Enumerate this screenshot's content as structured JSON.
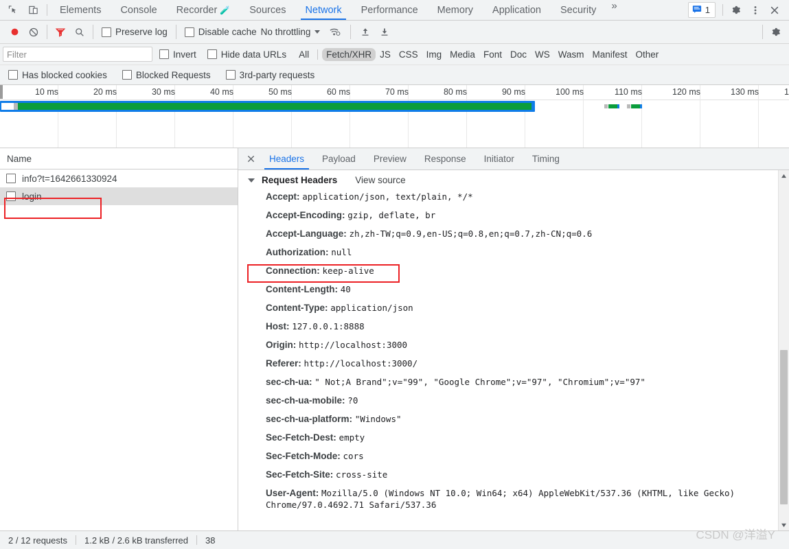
{
  "devtools": {
    "tabs": [
      {
        "label": "Elements",
        "active": false,
        "warn": false
      },
      {
        "label": "Console",
        "active": false,
        "warn": false
      },
      {
        "label": "Recorder",
        "active": false,
        "warn": true
      },
      {
        "label": "Sources",
        "active": false,
        "warn": false
      },
      {
        "label": "Network",
        "active": true,
        "warn": false
      },
      {
        "label": "Performance",
        "active": false,
        "warn": false
      },
      {
        "label": "Memory",
        "active": false,
        "warn": false
      },
      {
        "label": "Application",
        "active": false,
        "warn": false
      },
      {
        "label": "Security",
        "active": false,
        "warn": false
      }
    ],
    "more_tabs_glyph": "»",
    "message_count": "1",
    "icons": {
      "inspect": "inspect-element-icon",
      "device": "device-toolbar-icon",
      "messages": "message-badge-icon",
      "settings": "gear-icon",
      "kebab": "kebab-menu-icon",
      "close": "close-icon"
    },
    "accent_color": "#1a73e8"
  },
  "network_toolbar": {
    "record_label": "record-button",
    "clear_label": "clear-button",
    "filter_toggle_label": "filter-toggle-button",
    "search_label": "search-button",
    "preserve_log": {
      "label": "Preserve log",
      "checked": false
    },
    "disable_cache": {
      "label": "Disable cache",
      "checked": false
    },
    "throttling": {
      "value": "No throttling"
    },
    "wifi_label": "network-conditions-icon",
    "import_label": "import-har-button",
    "export_label": "export-har-button",
    "settings_label": "network-settings-icon",
    "record_color": "#e8302f",
    "filter_color": "#e8302f"
  },
  "filter_row": {
    "placeholder": "Filter",
    "value": "",
    "invert": {
      "label": "Invert",
      "checked": false
    },
    "hide_data_urls": {
      "label": "Hide data URLs",
      "checked": false
    },
    "types": [
      {
        "label": "All",
        "active": false
      },
      {
        "label": "Fetch/XHR",
        "active": true
      },
      {
        "label": "JS",
        "active": false
      },
      {
        "label": "CSS",
        "active": false
      },
      {
        "label": "Img",
        "active": false
      },
      {
        "label": "Media",
        "active": false
      },
      {
        "label": "Font",
        "active": false
      },
      {
        "label": "Doc",
        "active": false
      },
      {
        "label": "WS",
        "active": false
      },
      {
        "label": "Wasm",
        "active": false
      },
      {
        "label": "Manifest",
        "active": false
      },
      {
        "label": "Other",
        "active": false
      }
    ]
  },
  "checkbox_row": {
    "has_blocked_cookies": {
      "label": "Has blocked cookies",
      "checked": false
    },
    "blocked_requests": {
      "label": "Blocked Requests",
      "checked": false
    },
    "third_party_requests": {
      "label": "3rd-party requests",
      "checked": false
    }
  },
  "overview": {
    "ticks": [
      "10 ms",
      "20 ms",
      "30 ms",
      "40 ms",
      "50 ms",
      "60 ms",
      "70 ms",
      "80 ms",
      "90 ms",
      "100 ms",
      "110 ms",
      "120 ms",
      "130 ms",
      "1"
    ],
    "colors": {
      "blue": "#0f7ce8",
      "green": "#0b9d3b",
      "gray": "#b9b9b9"
    }
  },
  "requests_pane": {
    "column_header": "Name",
    "rows": [
      {
        "name": "info?t=1642661330924",
        "selected": false
      },
      {
        "name": "login",
        "selected": true
      }
    ]
  },
  "detail_pane": {
    "tabs": [
      {
        "label": "Headers",
        "active": true
      },
      {
        "label": "Payload",
        "active": false
      },
      {
        "label": "Preview",
        "active": false
      },
      {
        "label": "Response",
        "active": false
      },
      {
        "label": "Initiator",
        "active": false
      },
      {
        "label": "Timing",
        "active": false
      }
    ],
    "section_title": "Request Headers",
    "view_source": "View source",
    "headers": [
      {
        "name": "Accept:",
        "value": "application/json, text/plain, */*"
      },
      {
        "name": "Accept-Encoding:",
        "value": "gzip, deflate, br"
      },
      {
        "name": "Accept-Language:",
        "value": "zh,zh-TW;q=0.9,en-US;q=0.8,en;q=0.7,zh-CN;q=0.6"
      },
      {
        "name": "Authorization:",
        "value": "null"
      },
      {
        "name": "Connection:",
        "value": "keep-alive"
      },
      {
        "name": "Content-Length:",
        "value": "40"
      },
      {
        "name": "Content-Type:",
        "value": "application/json"
      },
      {
        "name": "Host:",
        "value": "127.0.0.1:8888"
      },
      {
        "name": "Origin:",
        "value": "http://localhost:3000"
      },
      {
        "name": "Referer:",
        "value": "http://localhost:3000/"
      },
      {
        "name": "sec-ch-ua:",
        "value": "\" Not;A Brand\";v=\"99\", \"Google Chrome\";v=\"97\", \"Chromium\";v=\"97\""
      },
      {
        "name": "sec-ch-ua-mobile:",
        "value": "?0"
      },
      {
        "name": "sec-ch-ua-platform:",
        "value": "\"Windows\""
      },
      {
        "name": "Sec-Fetch-Dest:",
        "value": "empty"
      },
      {
        "name": "Sec-Fetch-Mode:",
        "value": "cors"
      },
      {
        "name": "Sec-Fetch-Site:",
        "value": "cross-site"
      },
      {
        "name": "User-Agent:",
        "value": "Mozilla/5.0 (Windows NT 10.0; Win64; x64) AppleWebKit/537.36 (KHTML, like Gecko) Chrome/97.0.4692.71 Safari/537.36"
      }
    ]
  },
  "status_bar": {
    "requests": "2 / 12 requests",
    "transferred": "1.2 kB / 2.6 kB transferred",
    "resources": "38"
  },
  "annotations": {
    "highlight_color": "#ec2024",
    "login_highlight": "login-row-highlight",
    "authorization_highlight": "authorization-header-highlight"
  },
  "watermark": "CSDN @洋溢Y"
}
